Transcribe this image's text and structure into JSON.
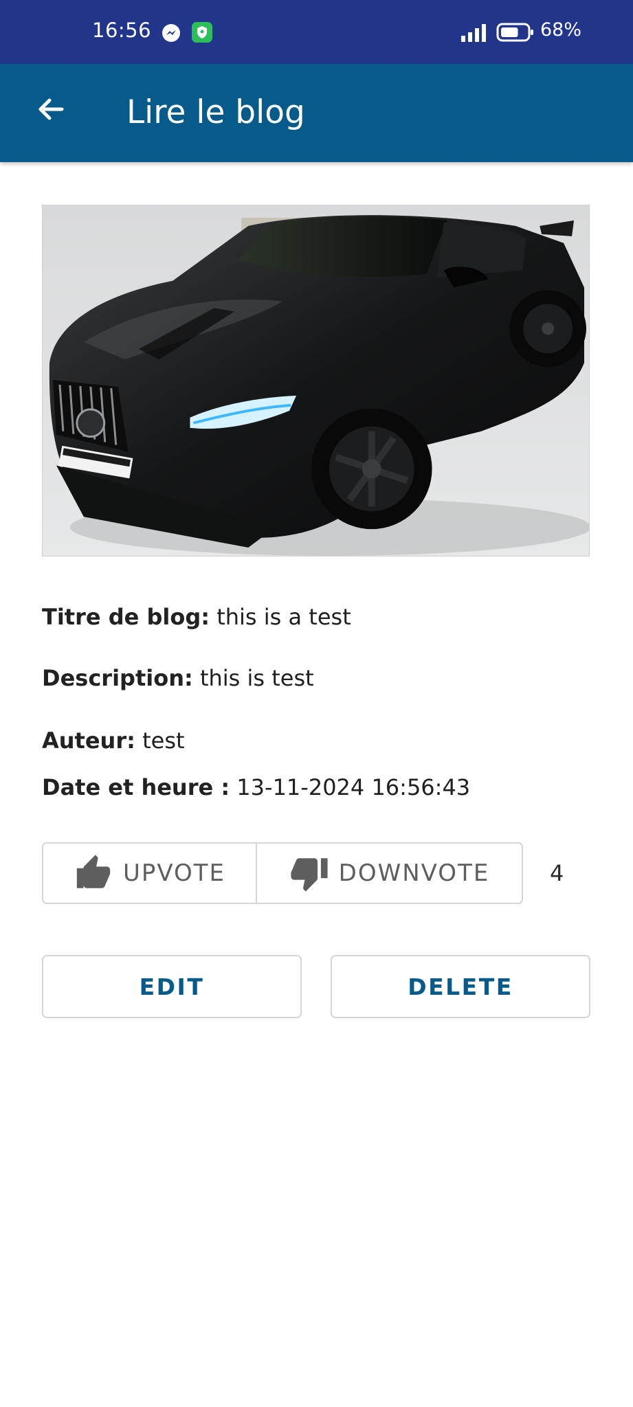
{
  "status_bar": {
    "time": "16:56",
    "battery_percent": "68%",
    "battery_level": 0.68,
    "icons": [
      "messenger-icon",
      "shield-icon",
      "signal-icon",
      "battery-icon"
    ]
  },
  "app_bar": {
    "title": "Lire le blog",
    "back_icon": "arrow-left-icon"
  },
  "blog": {
    "image": "black sports sedan car photo",
    "title_label": "Titre de blog:",
    "title_value": "this is a test",
    "description_label": "Description:",
    "description_value": "this is test",
    "author_label": "Auteur:",
    "author_value": "test",
    "datetime_label": "Date et heure :",
    "datetime_value": "13-11-2024 16:56:43"
  },
  "votes": {
    "upvote_label": "UPVOTE",
    "downvote_label": "DOWNVOTE",
    "count": "4"
  },
  "actions": {
    "edit_label": "EDIT",
    "delete_label": "DELETE"
  },
  "colors": {
    "status_bar": "#21358b",
    "app_bar": "#075b8b",
    "accent_text": "#075b8b"
  }
}
